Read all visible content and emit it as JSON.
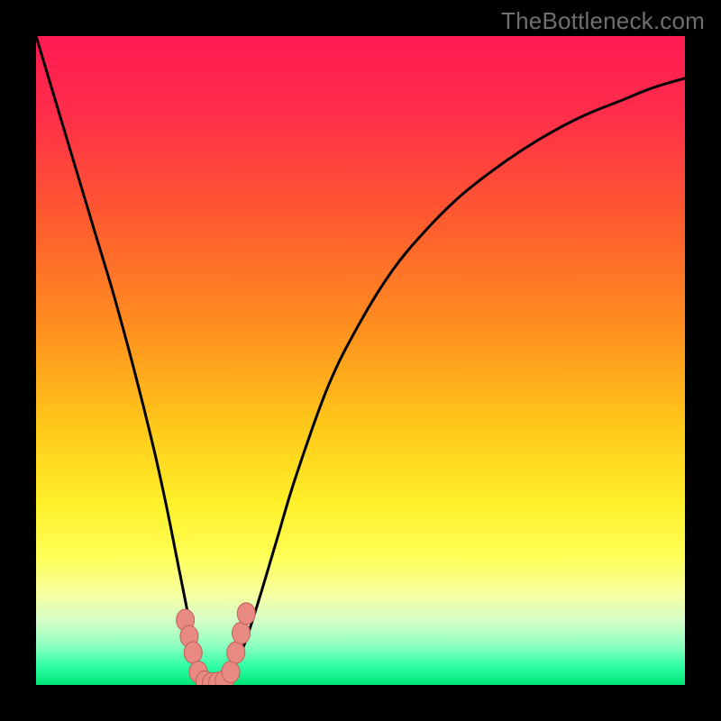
{
  "watermark": "TheBottleneck.com",
  "colors": {
    "gradient_stops": [
      {
        "offset": 0.0,
        "color": "#ff1a52"
      },
      {
        "offset": 0.12,
        "color": "#ff2e4a"
      },
      {
        "offset": 0.28,
        "color": "#ff5a2f"
      },
      {
        "offset": 0.45,
        "color": "#ff8f1f"
      },
      {
        "offset": 0.6,
        "color": "#ffc81a"
      },
      {
        "offset": 0.72,
        "color": "#fff029"
      },
      {
        "offset": 0.8,
        "color": "#ffff55"
      },
      {
        "offset": 0.86,
        "color": "#f6ffa0"
      },
      {
        "offset": 0.9,
        "color": "#d6ffc8"
      },
      {
        "offset": 0.94,
        "color": "#8cffc0"
      },
      {
        "offset": 0.97,
        "color": "#33ffa8"
      },
      {
        "offset": 1.0,
        "color": "#00e676"
      }
    ],
    "curve_stroke": "#000000",
    "marker_fill": "#e88a82",
    "marker_stroke": "#c06058"
  },
  "chart_data": {
    "type": "line",
    "title": "",
    "xlabel": "",
    "ylabel": "",
    "xlim": [
      0,
      100
    ],
    "ylim": [
      0,
      100
    ],
    "notch_x": 27,
    "series": [
      {
        "name": "bottleneck_curve",
        "x": [
          0,
          3,
          6,
          9,
          12,
          15,
          18,
          20,
          22,
          24,
          25,
          26,
          27,
          28,
          29,
          30,
          32,
          34,
          37,
          40,
          45,
          50,
          55,
          60,
          65,
          70,
          75,
          80,
          85,
          90,
          95,
          100
        ],
        "y": [
          100,
          90,
          80,
          70,
          60,
          49,
          37,
          28,
          18,
          8,
          3,
          0.5,
          0,
          0.5,
          1,
          2,
          6,
          12,
          22,
          32,
          46,
          56,
          64,
          70,
          75,
          79,
          82.5,
          85.5,
          88,
          90,
          92,
          93.5
        ]
      }
    ],
    "markers": [
      {
        "x": 23.0,
        "y": 10.0
      },
      {
        "x": 23.6,
        "y": 7.5
      },
      {
        "x": 24.2,
        "y": 5.0
      },
      {
        "x": 25.0,
        "y": 2.0
      },
      {
        "x": 26.0,
        "y": 0.5
      },
      {
        "x": 27.0,
        "y": 0.2
      },
      {
        "x": 28.0,
        "y": 0.3
      },
      {
        "x": 29.0,
        "y": 0.6
      },
      {
        "x": 30.0,
        "y": 2.0
      },
      {
        "x": 30.8,
        "y": 5.0
      },
      {
        "x": 31.6,
        "y": 8.0
      },
      {
        "x": 32.4,
        "y": 11.0
      }
    ]
  }
}
